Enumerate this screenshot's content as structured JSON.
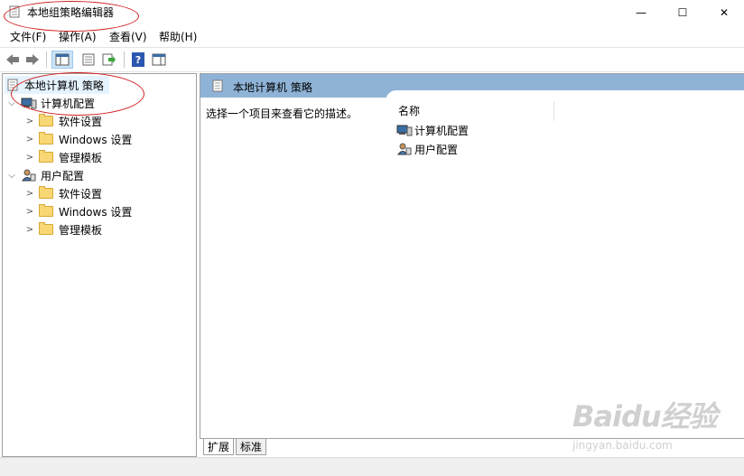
{
  "window": {
    "title": "本地组策略编辑器",
    "minimize_glyph": "—",
    "maximize_glyph": "☐",
    "close_glyph": "✕"
  },
  "menu": [
    "文件(F)",
    "操作(A)",
    "查看(V)",
    "帮助(H)"
  ],
  "toolbar": {
    "buttons": [
      "back-icon",
      "forward-icon",
      "show-hide-tree-icon",
      "properties-icon",
      "export-list-icon",
      "help-icon",
      "action-pane-icon"
    ]
  },
  "tree": {
    "root": "本地计算机 策略",
    "computer_config": {
      "label": "计算机配置",
      "children": [
        "软件设置",
        "Windows 设置",
        "管理模板"
      ]
    },
    "user_config": {
      "label": "用户配置",
      "children": [
        "软件设置",
        "Windows 设置",
        "管理模板"
      ]
    }
  },
  "right_pane": {
    "header": "本地计算机 策略",
    "description": "选择一个项目来查看它的描述。",
    "column_name": "名称",
    "items": [
      "计算机配置",
      "用户配置"
    ]
  },
  "tabs": [
    "扩展",
    "标准"
  ],
  "watermark": {
    "logo": "Baidu经验",
    "url": "jingyan.baidu.com"
  },
  "colors": {
    "annotation": "#d0201f",
    "header_bar": "#8fb3d7",
    "selection": "#e5f3ff"
  }
}
